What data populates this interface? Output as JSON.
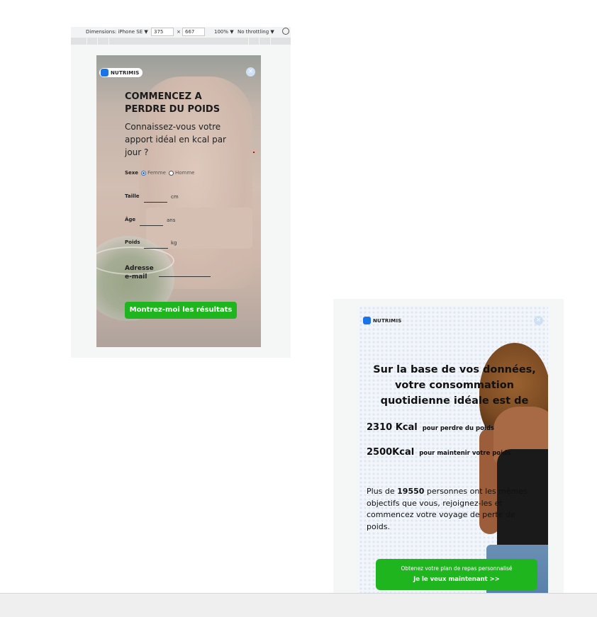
{
  "devtools": {
    "dimensions_label": "Dimensions: iPhone SE ▼",
    "width_value": "375",
    "times": "×",
    "height_value": "667",
    "zoom": "100% ▼",
    "throttle": "No throttling ▼",
    "rotate_icon": "rotate-icon"
  },
  "left_popup": {
    "logo_text": "NUTRIMIS",
    "close_icon": "×",
    "headline": "COMMENCEZ A PERDRE DU POIDS",
    "subheadline": "Connaissez-vous votre apport idéal en kcal par jour ?",
    "sexe": {
      "label": "Sexe",
      "options": [
        "Femme",
        "Homme"
      ],
      "selected": "Femme"
    },
    "fields": {
      "taille": {
        "label": "Taille",
        "unit": "cm"
      },
      "age": {
        "label": "Âge",
        "unit": "ans"
      },
      "poids": {
        "label": "Poids",
        "unit": "kg"
      },
      "email": {
        "label_line1": "Adresse",
        "label_line2": "e-mail"
      }
    },
    "cta": "Montrez-moi les résultats",
    "cta_color": "#1fb51f"
  },
  "right_popup": {
    "logo_text": "NUTRIMIS",
    "close_icon": "×",
    "headline": "Sur la base de vos données, votre consommation quotidienne idéale est de",
    "kcal_lose": {
      "value": "2310 Kcal",
      "label": "pour perdre du poids"
    },
    "kcal_maintain": {
      "value": "2500Kcal",
      "label": "pour maintenir votre poids"
    },
    "paragraph": {
      "before": "Plus de ",
      "count": "19550",
      "after": " personnes ont les mêmes objectifs que vous, rejoignez-les et commencez votre voyage de perte de poids."
    },
    "cta_line1": "Obtenez votre plan de repas personnalisé",
    "cta_line2": "Je le veux maintenant >>",
    "cta_color": "#1fb51f"
  }
}
